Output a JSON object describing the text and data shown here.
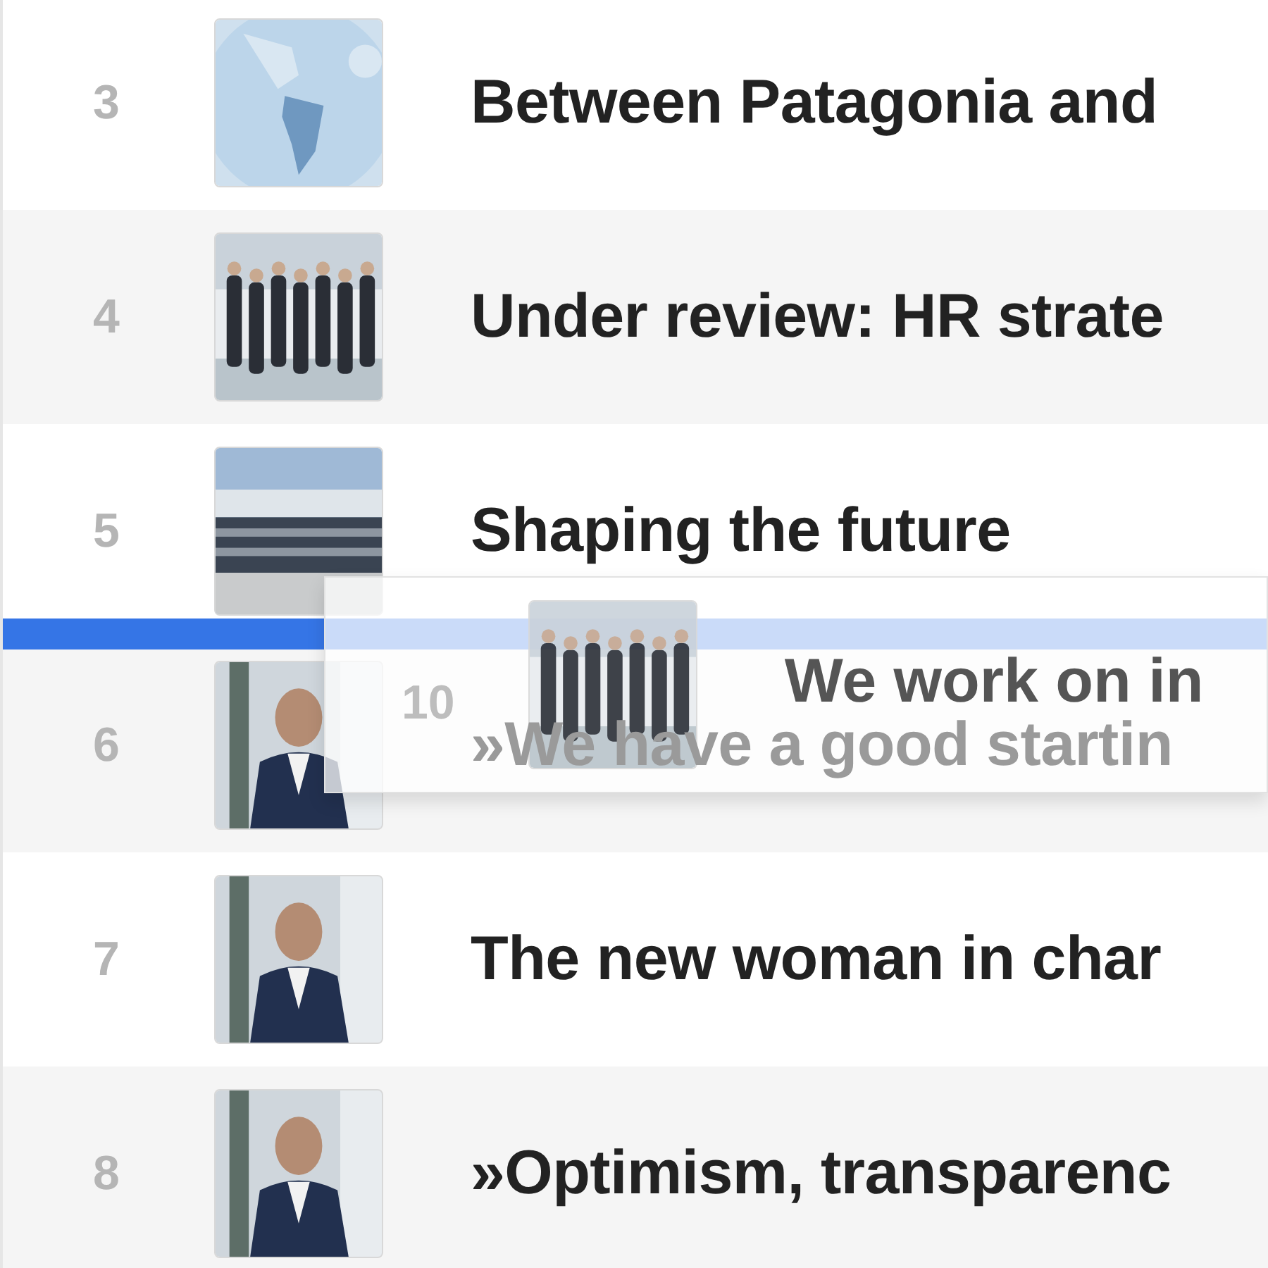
{
  "rows": [
    {
      "kind": "row",
      "number": "3",
      "title": "Between Patagonia and",
      "picture": {
        "kind": "map"
      }
    },
    {
      "kind": "row",
      "number": "4",
      "title": "Under review: HR strate",
      "picture": {
        "kind": "group"
      }
    },
    {
      "kind": "row",
      "number": "5",
      "title": "Shaping the future",
      "picture": {
        "kind": "crowd"
      }
    },
    {
      "kind": "drop_indicator",
      "dragged": {
        "number": "10",
        "title": "We work on in",
        "picture": {
          "kind": "group"
        }
      }
    },
    {
      "kind": "row",
      "number": "6",
      "title": "»We have a good startin",
      "picture": {
        "kind": "portrait"
      }
    },
    {
      "kind": "row",
      "number": "7",
      "title": "The new woman in char",
      "picture": {
        "kind": "portrait"
      }
    },
    {
      "kind": "row",
      "number": "8",
      "title": "»Optimism, transparenc",
      "picture": {
        "kind": "portrait"
      }
    }
  ]
}
